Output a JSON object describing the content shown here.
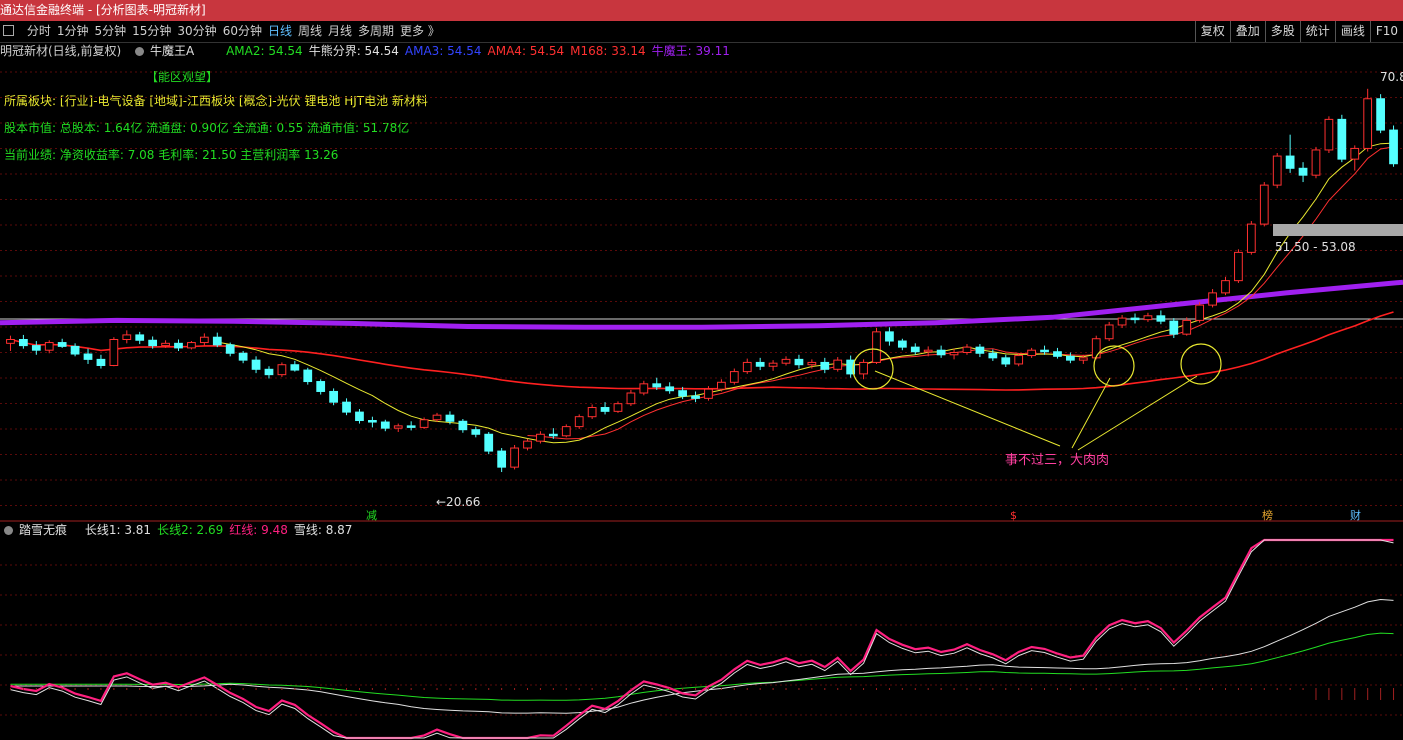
{
  "window": {
    "title": "通达信金融终端 - [分析图表-明冠新材]"
  },
  "toolbar": {
    "periods": [
      "分时",
      "1分钟",
      "5分钟",
      "15分钟",
      "30分钟",
      "60分钟",
      "日线",
      "周线",
      "月线",
      "多周期",
      "更多 》"
    ],
    "active_period": "日线",
    "right_buttons": [
      "复权",
      "叠加",
      "多股",
      "统计",
      "画线",
      "F10"
    ]
  },
  "legend": {
    "stock": "明冠新材(日线,前复权)",
    "indicator_name": "牛魔王A",
    "items": [
      {
        "text": "AMA2: 54.54",
        "color": "#22dd22"
      },
      {
        "text": "牛熊分界: 54.54",
        "color": "#e0e0e0"
      },
      {
        "text": "AMA3: 54.54",
        "color": "#3344ff"
      },
      {
        "text": "AMA4: 54.54",
        "color": "#ff3030"
      },
      {
        "text": "M168: 33.14",
        "color": "#ff3030"
      },
      {
        "text": "牛魔王: 39.11",
        "color": "#a020f0"
      }
    ]
  },
  "info": {
    "zone": "【能区观望】",
    "sectors": "所属板块: [行业]-电气设备 [地域]-江西板块 [概念]-光伏 锂电池 HJT电池 新材料",
    "shares": "股本市值: 总股本: 1.64亿 流通盘: 0.90亿 全流通: 0.55 流通市值: 51.78亿",
    "performance": "当前业绩:  净资收益率: 7.08 毛利率: 21.50 主营利润率 13.26"
  },
  "annotations": {
    "high": "70.8",
    "low": "←20.66",
    "range": "51.50 - 53.08",
    "note": "事不过三，大肉肉",
    "markers": [
      "减",
      "$",
      "榜",
      "财"
    ]
  },
  "indicator": {
    "name": "踏雪无痕",
    "items": [
      {
        "text": "长线1: 3.81",
        "color": "#e0e0e0"
      },
      {
        "text": "长线2: 2.69",
        "color": "#22dd22"
      },
      {
        "text": "红线: 9.48",
        "color": "#ff2080"
      },
      {
        "text": "雪线: 8.87",
        "color": "#e0e0e0"
      }
    ]
  },
  "colors": {
    "up": "#ff3030",
    "down": "#54ffff",
    "ma_purple": "#a020f0",
    "ma_red": "#ff2020",
    "ma_yellow": "#e8e830",
    "titlebar": "#c8363e"
  },
  "chart_data": {
    "type": "candlestick",
    "price_range": [
      20.66,
      70.8
    ],
    "low_label": 20.66,
    "high_label": 70.8,
    "ohlc_samples": [
      [
        37.5,
        38.5,
        36.5,
        38.0
      ],
      [
        38.0,
        38.6,
        36.8,
        37.2
      ],
      [
        37.2,
        37.8,
        36.0,
        36.6
      ],
      [
        36.6,
        37.9,
        36.2,
        37.6
      ],
      [
        37.6,
        38.1,
        36.9,
        37.1
      ],
      [
        37.1,
        37.5,
        35.8,
        36.1
      ],
      [
        36.1,
        36.8,
        34.8,
        35.4
      ],
      [
        35.4,
        36.0,
        34.2,
        34.6
      ],
      [
        34.6,
        38.3,
        34.5,
        38.0
      ],
      [
        38.0,
        39.2,
        37.5,
        38.6
      ],
      [
        38.6,
        39.0,
        37.4,
        37.9
      ],
      [
        37.9,
        38.4,
        36.8,
        37.2
      ],
      [
        37.2,
        37.9,
        36.9,
        37.5
      ],
      [
        37.5,
        38.0,
        36.5,
        36.9
      ],
      [
        36.9,
        37.8,
        36.7,
        37.6
      ],
      [
        37.6,
        38.8,
        37.2,
        38.3
      ],
      [
        38.3,
        38.9,
        37.0,
        37.3
      ],
      [
        37.3,
        37.6,
        35.8,
        36.2
      ],
      [
        36.2,
        36.5,
        34.9,
        35.3
      ],
      [
        35.3,
        35.8,
        33.6,
        34.1
      ],
      [
        34.1,
        34.5,
        32.9,
        33.4
      ],
      [
        33.4,
        35.0,
        33.1,
        34.7
      ],
      [
        34.7,
        35.2,
        33.8,
        34.0
      ],
      [
        34.0,
        34.3,
        32.1,
        32.5
      ],
      [
        32.5,
        32.8,
        30.8,
        31.2
      ],
      [
        31.2,
        31.6,
        29.4,
        29.8
      ],
      [
        29.8,
        30.3,
        28.1,
        28.5
      ],
      [
        28.5,
        28.9,
        27.0,
        27.4
      ],
      [
        27.4,
        27.9,
        26.5,
        27.2
      ],
      [
        27.2,
        27.5,
        26.0,
        26.4
      ],
      [
        26.4,
        27.0,
        25.9,
        26.7
      ],
      [
        26.7,
        27.3,
        26.1,
        26.5
      ],
      [
        26.5,
        27.8,
        26.3,
        27.5
      ],
      [
        27.5,
        28.4,
        27.2,
        28.1
      ],
      [
        28.1,
        28.6,
        26.9,
        27.3
      ],
      [
        27.3,
        27.6,
        25.8,
        26.2
      ],
      [
        26.2,
        26.6,
        25.2,
        25.6
      ],
      [
        25.6,
        25.9,
        23.0,
        23.4
      ],
      [
        23.4,
        23.8,
        20.66,
        21.3
      ],
      [
        21.3,
        24.2,
        21.0,
        23.8
      ],
      [
        23.8,
        25.0,
        23.5,
        24.7
      ],
      [
        24.7,
        26.0,
        24.4,
        25.6
      ],
      [
        25.6,
        26.4,
        25.0,
        25.4
      ],
      [
        25.4,
        26.9,
        25.2,
        26.6
      ],
      [
        26.6,
        28.2,
        26.3,
        27.9
      ],
      [
        27.9,
        29.5,
        27.6,
        29.1
      ],
      [
        29.1,
        29.8,
        28.2,
        28.6
      ],
      [
        28.6,
        29.9,
        28.4,
        29.6
      ],
      [
        29.6,
        31.4,
        29.3,
        31.0
      ],
      [
        31.0,
        32.6,
        30.7,
        32.2
      ],
      [
        32.2,
        33.0,
        31.4,
        31.8
      ],
      [
        31.8,
        32.4,
        30.9,
        31.3
      ],
      [
        31.3,
        31.8,
        30.2,
        30.6
      ],
      [
        30.6,
        31.2,
        29.8,
        30.3
      ],
      [
        30.3,
        31.9,
        30.0,
        31.5
      ],
      [
        31.5,
        32.8,
        31.2,
        32.4
      ],
      [
        32.4,
        34.2,
        32.1,
        33.8
      ],
      [
        33.8,
        35.5,
        33.5,
        35.0
      ],
      [
        35.0,
        35.6,
        34.0,
        34.5
      ],
      [
        34.5,
        35.3,
        33.9,
        34.9
      ],
      [
        34.9,
        35.8,
        34.6,
        35.4
      ],
      [
        35.4,
        36.0,
        34.2,
        34.7
      ],
      [
        34.7,
        35.4,
        34.2,
        35.0
      ],
      [
        35.0,
        35.6,
        33.6,
        34.1
      ],
      [
        34.1,
        35.7,
        33.8,
        35.3
      ],
      [
        35.3,
        35.9,
        33.0,
        33.5
      ],
      [
        33.5,
        35.4,
        32.8,
        35.0
      ],
      [
        35.0,
        39.5,
        34.8,
        39.0
      ],
      [
        39.0,
        39.6,
        37.2,
        37.8
      ],
      [
        37.8,
        38.1,
        36.6,
        37.0
      ],
      [
        37.0,
        37.5,
        36.0,
        36.4
      ],
      [
        36.4,
        37.1,
        35.8,
        36.6
      ],
      [
        36.6,
        37.2,
        35.6,
        36.0
      ],
      [
        36.0,
        36.8,
        35.4,
        36.3
      ],
      [
        36.3,
        37.4,
        36.0,
        37.0
      ],
      [
        37.0,
        37.4,
        35.7,
        36.2
      ],
      [
        36.2,
        36.7,
        35.2,
        35.6
      ],
      [
        35.6,
        36.0,
        34.4,
        34.8
      ],
      [
        34.8,
        36.2,
        34.5,
        35.9
      ],
      [
        35.9,
        36.9,
        35.6,
        36.6
      ],
      [
        36.6,
        37.2,
        36.0,
        36.4
      ],
      [
        36.4,
        36.9,
        35.5,
        35.8
      ],
      [
        35.8,
        36.3,
        34.9,
        35.3
      ],
      [
        35.3,
        36.0,
        34.8,
        35.6
      ],
      [
        35.6,
        38.5,
        35.4,
        38.1
      ],
      [
        38.1,
        40.3,
        37.8,
        39.9
      ],
      [
        39.9,
        41.2,
        39.5,
        40.8
      ],
      [
        40.8,
        41.4,
        40.1,
        40.6
      ],
      [
        40.6,
        41.5,
        40.3,
        41.1
      ],
      [
        41.1,
        41.8,
        40.0,
        40.4
      ],
      [
        40.4,
        40.8,
        38.2,
        38.7
      ],
      [
        38.7,
        40.9,
        38.5,
        40.5
      ],
      [
        40.5,
        42.9,
        40.2,
        42.5
      ],
      [
        42.5,
        44.6,
        42.2,
        44.1
      ],
      [
        44.1,
        46.2,
        43.8,
        45.7
      ],
      [
        45.7,
        49.8,
        45.4,
        49.4
      ],
      [
        49.4,
        53.5,
        49.1,
        53.1
      ],
      [
        53.1,
        58.6,
        52.8,
        58.2
      ],
      [
        58.2,
        62.4,
        57.8,
        62.0
      ],
      [
        62.0,
        64.8,
        59.8,
        60.4
      ],
      [
        60.4,
        61.2,
        58.6,
        59.5
      ],
      [
        59.5,
        63.2,
        59.1,
        62.8
      ],
      [
        62.8,
        67.2,
        62.4,
        66.8
      ],
      [
        66.8,
        67.4,
        61.2,
        61.6
      ],
      [
        61.6,
        63.4,
        60.1,
        63.0
      ],
      [
        63.0,
        70.8,
        62.6,
        69.5
      ],
      [
        69.5,
        70.1,
        65.0,
        65.4
      ],
      [
        65.4,
        66.0,
        60.6,
        61.0
      ]
    ],
    "ma_purple": [
      40.2,
      40.5,
      40.4,
      40.1,
      39.7,
      39.6,
      39.6,
      39.8,
      40.2,
      40.9,
      42.5,
      44.1,
      45.5
    ],
    "indicator_lines": [
      "长线1",
      "长线2",
      "红线",
      "雪线"
    ]
  }
}
